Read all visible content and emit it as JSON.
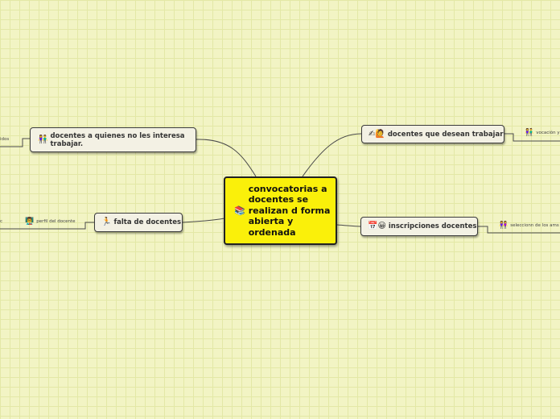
{
  "central": {
    "text": "convocatorias a docentes se realizan d forma abierta y ordenada",
    "icon": "📚"
  },
  "topics": {
    "no_interesa": {
      "text": "docentes a quienes no les interesa trabajar.",
      "icon": "👫"
    },
    "falta": {
      "text": "falta de docentes",
      "icon": "🏃"
    },
    "desean": {
      "text": "docentes que desean trabajar",
      "icon": "✍🙋"
    },
    "inscripciones": {
      "text": "inscripciones docentes",
      "icon": "📅😀"
    }
  },
  "leaves": {
    "no_interesa_leaf": {
      "text": "idos"
    },
    "falta_leaf": {
      "text": "perfil del docente",
      "icon": "👨‍🏫"
    },
    "falta_far": {
      "text": "c"
    },
    "desean_leaf": {
      "text": "vocación y",
      "icon": "👫"
    },
    "inscripciones_leaf": {
      "text": "seleccionn de los ams",
      "icon": "👭"
    }
  }
}
